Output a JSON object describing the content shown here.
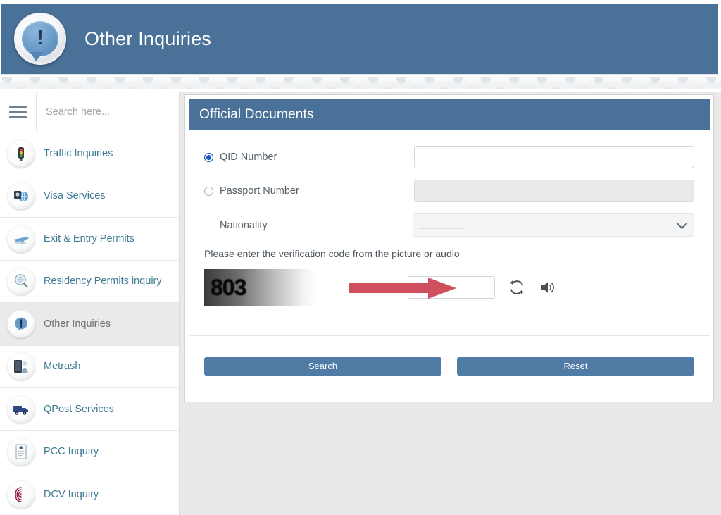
{
  "header": {
    "title": "Other Inquiries",
    "icon": "exclamation-speech-bubble-icon",
    "bang": "!",
    "bar_color": "#4a7299"
  },
  "sidebar": {
    "search": {
      "placeholder": "Search here...",
      "value": "",
      "menu_icon": "hamburger-icon"
    },
    "items": [
      {
        "label": "Traffic Inquiries",
        "icon": "traffic-light-icon",
        "selected": false
      },
      {
        "label": "Visa Services",
        "icon": "globe-passport-icon",
        "selected": false
      },
      {
        "label": "Exit & Entry Permits",
        "icon": "airplane-icon",
        "selected": false
      },
      {
        "label": "Residency Permits inquiry",
        "icon": "magnifier-globe-icon",
        "selected": false
      },
      {
        "label": "Other Inquiries",
        "icon": "exclamation-speech-bubble-icon",
        "selected": true
      },
      {
        "label": "Metrash",
        "icon": "mobile-phone-person-icon",
        "selected": false
      },
      {
        "label": "QPost Services",
        "icon": "delivery-van-icon",
        "selected": false
      },
      {
        "label": "PCC Inquiry",
        "icon": "certificate-document-icon",
        "selected": false
      },
      {
        "label": "DCV Inquiry",
        "icon": "fingerprint-icon",
        "selected": false
      }
    ]
  },
  "panel": {
    "title": "Official Documents",
    "title_bar_color": "#4a7299",
    "fields": {
      "qid": {
        "label": "QID Number",
        "radio_selected": true,
        "input_value": "",
        "input_placeholder": "",
        "enabled": true
      },
      "passport": {
        "label": "Passport Number",
        "radio_selected": false,
        "input_value": "",
        "input_placeholder": "",
        "enabled": false
      },
      "nationality": {
        "label": "Nationality",
        "selected_value": "--------------",
        "dropdown_icon": "chevron-down-icon"
      }
    },
    "verification": {
      "note": "Please enter the verification code from the picture or audio",
      "captcha_text": "803",
      "input_value": "",
      "refresh_icon": "refresh-icon",
      "audio_icon": "speaker-icon",
      "annotation_arrow": "red-arrow-pointing-right",
      "annotation_color": "#cf4f5f"
    },
    "buttons": {
      "search": "Search",
      "reset": "Reset",
      "color": "#4f7ba5"
    }
  }
}
